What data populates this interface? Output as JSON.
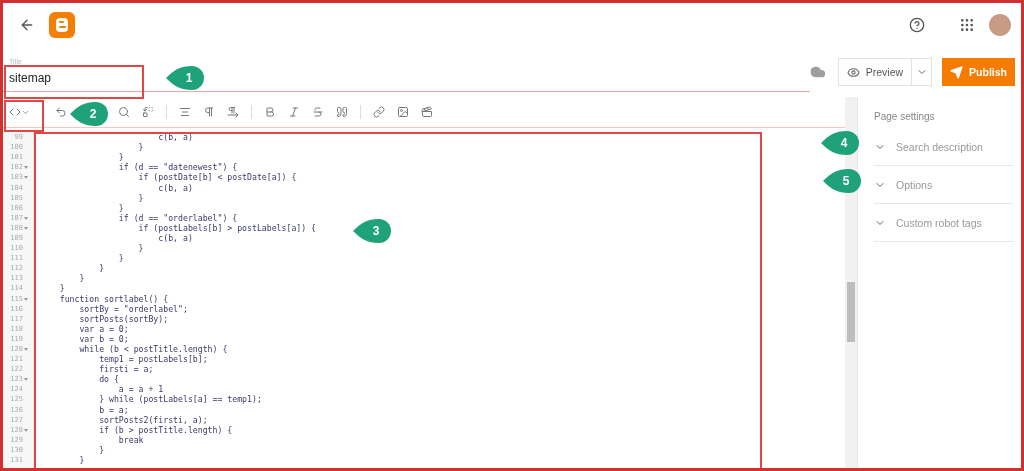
{
  "title_field": {
    "label": "Title",
    "value": "sitemap"
  },
  "actions": {
    "preview": "Preview",
    "publish": "Publish"
  },
  "editor": {
    "html_view": true
  },
  "code_lines": [
    {
      "number": "99",
      "fold": false,
      "text": "                        c(b, a)"
    },
    {
      "number": "100",
      "fold": false,
      "text": "                    }"
    },
    {
      "number": "101",
      "fold": false,
      "text": "                }"
    },
    {
      "number": "102",
      "fold": true,
      "text": "                if (d == \"datenewest\") {"
    },
    {
      "number": "103",
      "fold": true,
      "text": "                    if (postDate[b] < postDate[a]) {"
    },
    {
      "number": "104",
      "fold": false,
      "text": "                        c(b, a)"
    },
    {
      "number": "105",
      "fold": false,
      "text": "                    }"
    },
    {
      "number": "106",
      "fold": false,
      "text": "                }"
    },
    {
      "number": "107",
      "fold": true,
      "text": "                if (d == \"orderlabel\") {"
    },
    {
      "number": "108",
      "fold": true,
      "text": "                    if (postLabels[b] > postLabels[a]) {"
    },
    {
      "number": "109",
      "fold": false,
      "text": "                        c(b, a)"
    },
    {
      "number": "110",
      "fold": false,
      "text": "                    }"
    },
    {
      "number": "111",
      "fold": false,
      "text": "                }"
    },
    {
      "number": "112",
      "fold": false,
      "text": "            }"
    },
    {
      "number": "113",
      "fold": false,
      "text": "        }"
    },
    {
      "number": "114",
      "fold": false,
      "text": "    }"
    },
    {
      "number": "115",
      "fold": true,
      "text": "    function sortlabel() {"
    },
    {
      "number": "116",
      "fold": false,
      "text": "        sortBy = \"orderlabel\";"
    },
    {
      "number": "117",
      "fold": false,
      "text": "        sortPosts(sortBy);"
    },
    {
      "number": "118",
      "fold": false,
      "text": "        var a = 0;"
    },
    {
      "number": "119",
      "fold": false,
      "text": "        var b = 0;"
    },
    {
      "number": "120",
      "fold": true,
      "text": "        while (b < postTitle.length) {"
    },
    {
      "number": "121",
      "fold": false,
      "text": "            temp1 = postLabels[b];"
    },
    {
      "number": "122",
      "fold": false,
      "text": "            firsti = a;"
    },
    {
      "number": "123",
      "fold": true,
      "text": "            do {"
    },
    {
      "number": "124",
      "fold": false,
      "text": "                a = a + 1"
    },
    {
      "number": "125",
      "fold": false,
      "text": "            } while (postLabels[a] == temp1);"
    },
    {
      "number": "126",
      "fold": false,
      "text": "            b = a;"
    },
    {
      "number": "127",
      "fold": false,
      "text": "            sortPosts2(firsti, a);"
    },
    {
      "number": "128",
      "fold": true,
      "text": "            if (b > postTitle.length) {"
    },
    {
      "number": "129",
      "fold": false,
      "text": "                break"
    },
    {
      "number": "130",
      "fold": false,
      "text": "            }"
    },
    {
      "number": "131",
      "fold": false,
      "text": "        }"
    }
  ],
  "settings": {
    "heading": "Page settings",
    "items": [
      {
        "label": "Search description",
        "expanded": false
      },
      {
        "label": "Options",
        "expanded": false
      },
      {
        "label": "Custom robot tags",
        "expanded": false
      }
    ]
  },
  "callouts": [
    "1",
    "2",
    "3",
    "4",
    "5"
  ]
}
